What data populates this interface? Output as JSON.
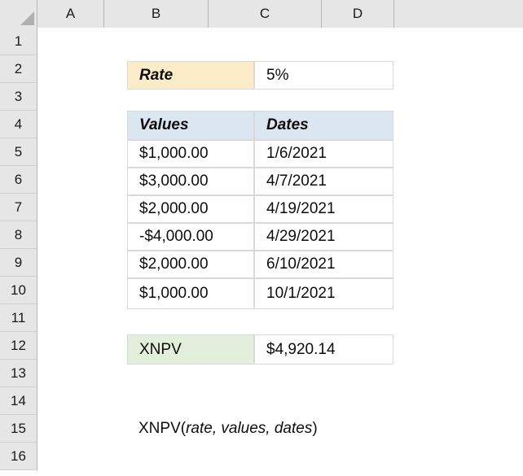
{
  "app": {
    "type": "spreadsheet",
    "corner_icon": "select-all-triangle-icon"
  },
  "grid": {
    "column_headers": [
      "A",
      "B",
      "C",
      "D"
    ],
    "row_headers": [
      "1",
      "2",
      "3",
      "4",
      "5",
      "6",
      "7",
      "8",
      "9",
      "10",
      "11",
      "12",
      "13",
      "14",
      "15",
      "16"
    ]
  },
  "colors": {
    "rate_label_fill": "#FDECC8",
    "table_header_fill": "#DCE6F1",
    "result_label_fill": "#E2EFDA",
    "cell_border": "#D9D9D9",
    "header_background": "#E6E6E6",
    "header_border": "#B6B6B6",
    "text": "#0D0D0D"
  },
  "rate_block": {
    "label": "Rate",
    "value": "5%"
  },
  "table": {
    "headers": [
      "Values",
      "Dates"
    ],
    "rows": [
      {
        "value": "$1,000.00",
        "date": "1/6/2021"
      },
      {
        "value": "$3,000.00",
        "date": "4/7/2021"
      },
      {
        "value": "$2,000.00",
        "date": "4/19/2021"
      },
      {
        "value": "-$4,000.00",
        "date": "4/29/2021"
      },
      {
        "value": "$2,000.00",
        "date": "6/10/2021"
      },
      {
        "value": "$1,000.00",
        "date": "10/1/2021"
      }
    ]
  },
  "result_block": {
    "label": "XNPV",
    "value": "$4,920.14"
  },
  "syntax": {
    "function_name": "XNPV(",
    "arguments": "rate, values, dates",
    "close_paren": ")"
  }
}
